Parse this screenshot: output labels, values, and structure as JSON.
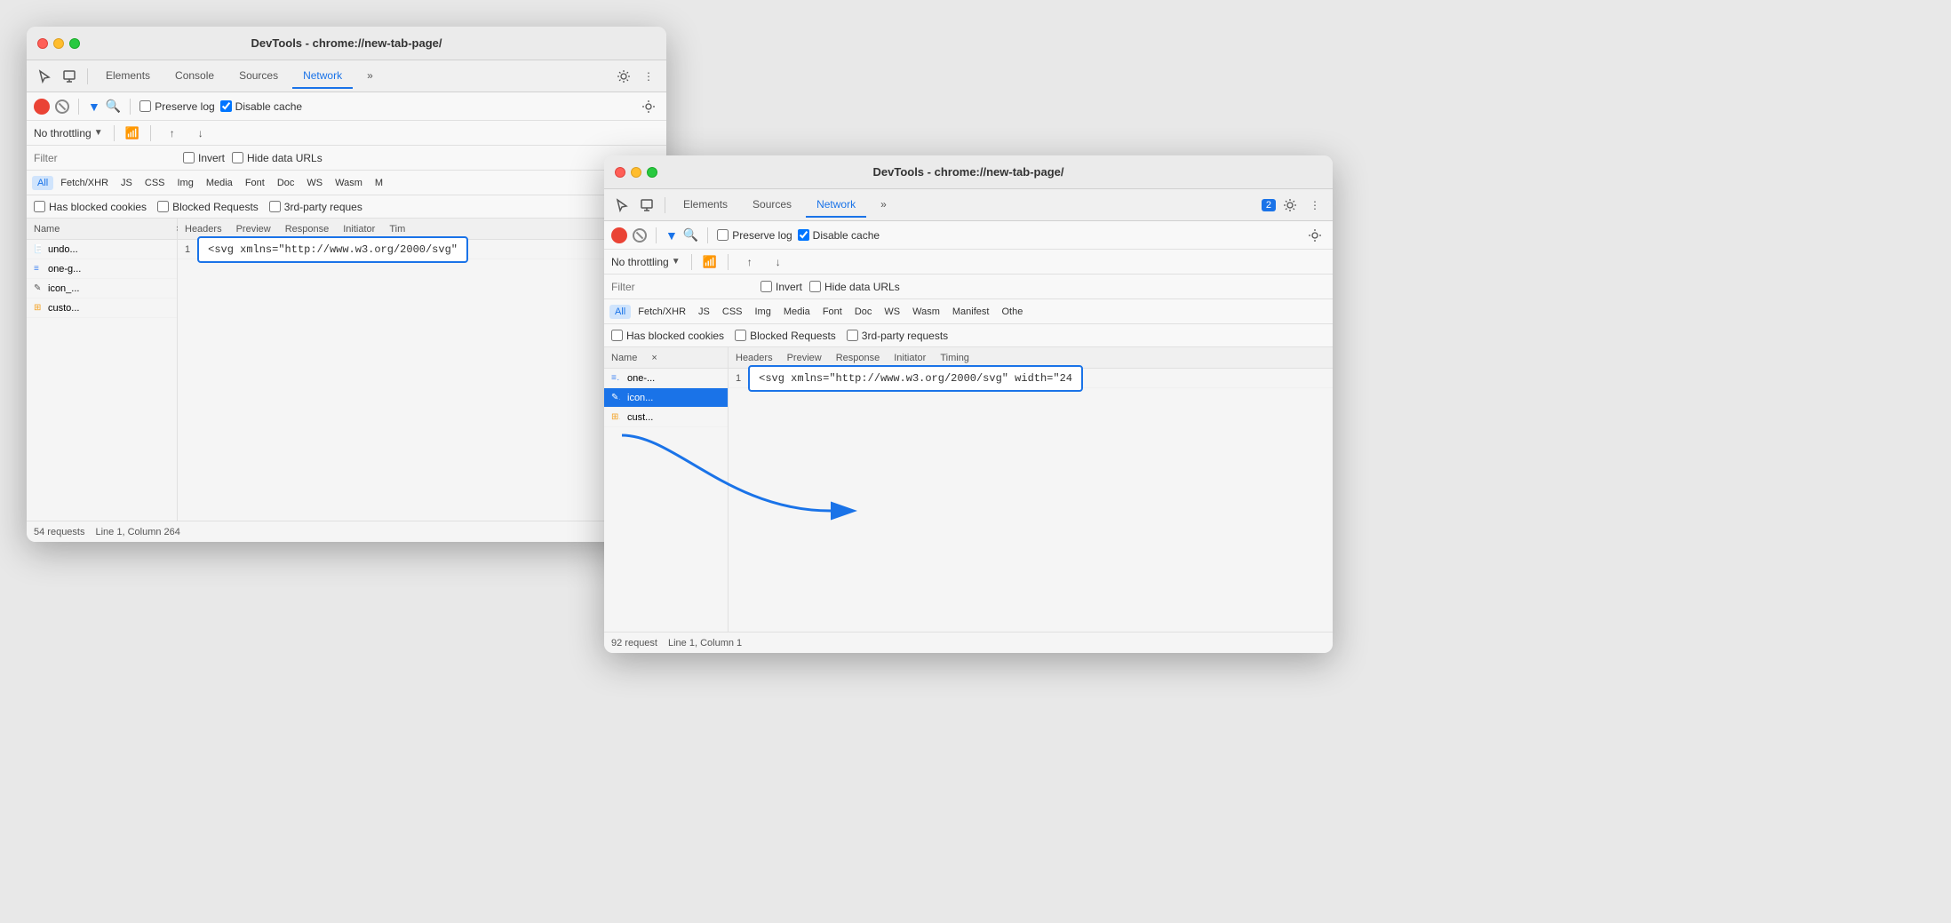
{
  "window1": {
    "title": "DevTools - chrome://new-tab-page/",
    "tabs": [
      "Elements",
      "Console",
      "Sources",
      "Network",
      "»"
    ],
    "active_tab": "Network",
    "network_toolbar": {
      "preserve_log_label": "Preserve log",
      "disable_cache_label": "Disable cache",
      "preserve_log_checked": false,
      "disable_cache_checked": true
    },
    "throttle": {
      "label": "No throttling"
    },
    "filter": {
      "placeholder": "Filter",
      "invert_label": "Invert",
      "hide_data_urls_label": "Hide data URLs"
    },
    "filter_types": [
      "All",
      "Fetch/XHR",
      "JS",
      "CSS",
      "Img",
      "Media",
      "Font",
      "Doc",
      "WS",
      "Wasm",
      "M"
    ],
    "active_filter_type": "All",
    "checkboxes": [
      "Has blocked cookies",
      "Blocked Requests",
      "3rd-party reques"
    ],
    "table_headers": [
      "Name",
      "×",
      "Headers",
      "Preview",
      "Response",
      "Initiator",
      "Tim"
    ],
    "rows": [
      {
        "icon": "page",
        "name": "undo...",
        "number": "1",
        "selected": false
      },
      {
        "icon": "doc",
        "name": "one-g...",
        "selected": false
      },
      {
        "icon": "edit",
        "name": "icon_...",
        "selected": false
      },
      {
        "icon": "puzzle",
        "name": "custo...",
        "selected": false
      }
    ],
    "response_preview": "<svg xmlns=\"http://www.w3.org/2000/svg\"",
    "status_bar": {
      "requests": "54 requests",
      "position": "Line 1, Column 264"
    }
  },
  "window2": {
    "title": "DevTools - chrome://new-tab-page/",
    "tabs": [
      "Elements",
      "Sources",
      "Network",
      "»"
    ],
    "active_tab": "Network",
    "badge": "2",
    "network_toolbar": {
      "preserve_log_label": "Preserve log",
      "disable_cache_label": "Disable cache",
      "preserve_log_checked": false,
      "disable_cache_checked": true
    },
    "throttle": {
      "label": "No throttling"
    },
    "filter": {
      "placeholder": "Filter",
      "invert_label": "Invert",
      "hide_data_urls_label": "Hide data URLs"
    },
    "filter_types": [
      "All",
      "Fetch/XHR",
      "JS",
      "CSS",
      "Img",
      "Media",
      "Font",
      "Doc",
      "WS",
      "Wasm",
      "Manifest",
      "Othe"
    ],
    "active_filter_type": "All",
    "checkboxes": [
      "Has blocked cookies",
      "Blocked Requests",
      "3rd-party requests"
    ],
    "table_headers": [
      "Name",
      "×",
      "Headers",
      "Preview",
      "Response",
      "Initiator",
      "Timing"
    ],
    "rows": [
      {
        "icon": "doc",
        "name": "one-...",
        "number": "1",
        "selected": false
      },
      {
        "icon": "edit",
        "name": "icon...",
        "selected": true
      },
      {
        "icon": "puzzle",
        "name": "cust...",
        "selected": false
      }
    ],
    "response_preview": "<svg xmlns=\"http://www.w3.org/2000/svg\" width=\"24",
    "status_bar": {
      "requests": "92 request",
      "position": "Line 1, Column 1"
    }
  }
}
